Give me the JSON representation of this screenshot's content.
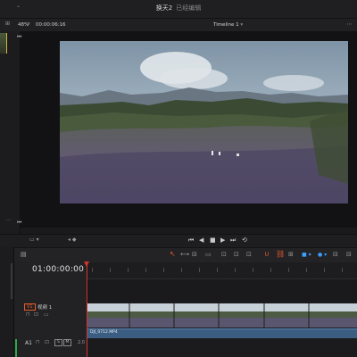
{
  "window": {
    "title": "换天2",
    "subtitle": "已经编辑"
  },
  "viewer": {
    "zoom": "48%",
    "timecode": "00:00:06:16",
    "timeline_label": "Timeline 1"
  },
  "timeline": {
    "timecode": "01:00:00:00",
    "video_track": {
      "id": "V1",
      "name": "视频 1"
    },
    "audio_track": {
      "id": "A1",
      "clip_label": "DJI_0712.MP4"
    },
    "audio_values": {
      "level": "2.0"
    }
  },
  "colors": {
    "playhead": "#d2352f",
    "audio_clip": "#3b5d82",
    "accent_orange": "#e85a2b",
    "accent_blue": "#3aa0ff"
  },
  "icons": [
    "left-panel-toggle-icon",
    "viewer-options-icon",
    "mark-icon",
    "skip-back-icon",
    "prev-frame-icon",
    "stop-icon",
    "play-icon",
    "skip-forward-icon",
    "loop-icon",
    "selection-tool-icon",
    "trim-tool-icon",
    "blade-tool-icon",
    "link-icon",
    "snap-icon",
    "flag-icon"
  ]
}
